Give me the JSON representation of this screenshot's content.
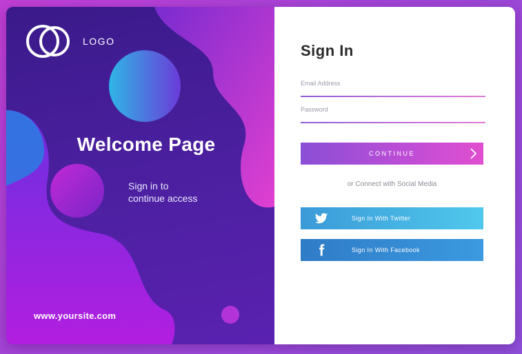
{
  "brand": {
    "logo_text": "LOGO",
    "site_url": "www.yoursite.com"
  },
  "hero": {
    "welcome_title": "Welcome Page",
    "subtitle_line1": "Sign in to",
    "subtitle_line2": "continue access"
  },
  "form": {
    "title": "Sign In",
    "email_label": "Email Address",
    "password_label": "Password",
    "continue_label": "CONTINUE",
    "social_text": "or Connect with Social Media",
    "twitter_label": "Sign In With Twitter",
    "facebook_label": "Sign In With Facebook"
  },
  "icons": {
    "logo": "logo-rings-icon",
    "continue": "chevron-right-icon",
    "twitter": "twitter-bird-icon",
    "facebook": "facebook-f-icon"
  },
  "colors": {
    "left_panel": "#4a1f9e",
    "accent_pink": "#d63fce",
    "accent_purple": "#8a4fd6",
    "twitter": "#4bb8e6",
    "facebook": "#2f7bc7",
    "text_dark": "#2a2a2a"
  }
}
